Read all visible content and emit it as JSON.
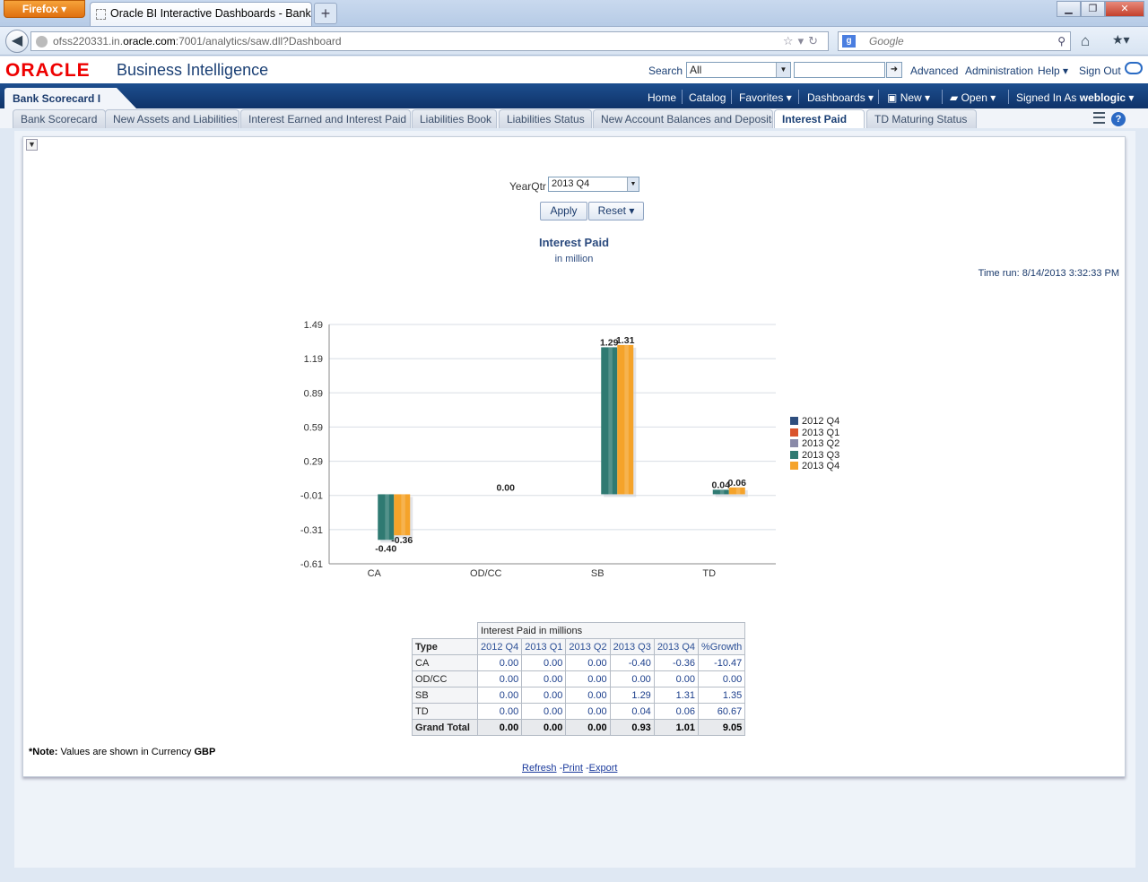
{
  "browser": {
    "menu_button": "Firefox",
    "tab_title": "Oracle BI Interactive Dashboards - Bank ...",
    "new_tab": "+",
    "url_host": "ofss220331.in.",
    "url_domain": "oracle.com",
    "url_path": ":7001/analytics/saw.dll?Dashboard",
    "search_placeholder": "Google",
    "search_engine_letter": "g"
  },
  "header": {
    "logo": "ORACLE",
    "product": "Business Intelligence",
    "search_label": "Search",
    "search_scope": "All",
    "links": [
      "Advanced",
      "Administration",
      "Help",
      "Sign Out"
    ]
  },
  "dashboard_bar": {
    "name": "Bank Scorecard I",
    "menu": [
      "Home",
      "Catalog",
      "Favorites",
      "Dashboards",
      "New",
      "Open",
      "Signed In As"
    ],
    "user": "weblogic"
  },
  "tabs": [
    {
      "label": "Bank Scorecard",
      "active": false
    },
    {
      "label": "New Assets and Liabilities",
      "active": false
    },
    {
      "label": "Interest Earned and Interest Paid",
      "active": false
    },
    {
      "label": "Liabilities Book",
      "active": false
    },
    {
      "label": "Liabilities Status",
      "active": false
    },
    {
      "label": "New Account Balances and Deposits",
      "active": false
    },
    {
      "label": "Interest Paid",
      "active": true
    },
    {
      "label": "TD Maturing Status",
      "active": false
    }
  ],
  "prompt": {
    "label": "YearQtr",
    "value": "2013 Q4",
    "apply": "Apply",
    "reset": "Reset"
  },
  "report": {
    "title": "Interest Paid",
    "subtitle": "in million",
    "time_run": "Time run: 8/14/2013 3:32:33 PM"
  },
  "chart_data": {
    "type": "bar",
    "categories": [
      "CA",
      "OD/CC",
      "SB",
      "TD"
    ],
    "ylim": [
      -0.61,
      1.49
    ],
    "yticks": [
      "1.49",
      "1.19",
      "0.89",
      "0.59",
      "0.29",
      "-0.01",
      "-0.31",
      "-0.61"
    ],
    "series": [
      {
        "name": "2012 Q4",
        "color": "#2e4e7e",
        "values": [
          0.0,
          0.0,
          0.0,
          0.0
        ]
      },
      {
        "name": "2013 Q1",
        "color": "#d9532c",
        "values": [
          0.0,
          0.0,
          0.0,
          0.0
        ]
      },
      {
        "name": "2013 Q2",
        "color": "#8a8aa8",
        "values": [
          0.0,
          0.0,
          0.0,
          0.0
        ]
      },
      {
        "name": "2013 Q3",
        "color": "#2f7a72",
        "values": [
          -0.4,
          0.0,
          1.29,
          0.04
        ]
      },
      {
        "name": "2013 Q4",
        "color": "#f5a32a",
        "values": [
          -0.36,
          0.0,
          1.31,
          0.06
        ]
      }
    ],
    "data_labels": [
      {
        "category": "CA",
        "series": "2013 Q3",
        "text": "-0.40"
      },
      {
        "category": "CA",
        "series": "2013 Q4",
        "text": "-0.36"
      },
      {
        "category": "OD/CC",
        "series": "2013 Q3",
        "text": "0.00"
      },
      {
        "category": "SB",
        "series": "2013 Q3",
        "text": "1.29"
      },
      {
        "category": "SB",
        "series": "2013 Q4",
        "text": "1.31"
      },
      {
        "category": "TD",
        "series": "2013 Q3",
        "text": "0.04"
      },
      {
        "category": "TD",
        "series": "2013 Q4",
        "text": "0.06"
      }
    ],
    "grid": true,
    "legend": "right"
  },
  "table": {
    "measure_header": "Interest Paid in millions",
    "type_header": "Type",
    "columns": [
      "2012 Q4",
      "2013 Q1",
      "2013 Q2",
      "2013 Q3",
      "2013 Q4",
      "%Growth"
    ],
    "rows": [
      {
        "type": "CA",
        "values": [
          "0.00",
          "0.00",
          "0.00",
          "-0.40",
          "-0.36",
          "-10.47"
        ]
      },
      {
        "type": "OD/CC",
        "values": [
          "0.00",
          "0.00",
          "0.00",
          "0.00",
          "0.00",
          "0.00"
        ]
      },
      {
        "type": "SB",
        "values": [
          "0.00",
          "0.00",
          "0.00",
          "1.29",
          "1.31",
          "1.35"
        ]
      },
      {
        "type": "TD",
        "values": [
          "0.00",
          "0.00",
          "0.00",
          "0.04",
          "0.06",
          "60.67"
        ]
      }
    ],
    "grand_total": {
      "label": "Grand Total",
      "values": [
        "0.00",
        "0.00",
        "0.00",
        "0.93",
        "1.01",
        "9.05"
      ]
    }
  },
  "footer": {
    "note_prefix": "*Note:",
    "note_text": " Values are shown in Currency ",
    "currency": "GBP",
    "links": [
      "Refresh",
      "Print",
      "Export"
    ]
  }
}
